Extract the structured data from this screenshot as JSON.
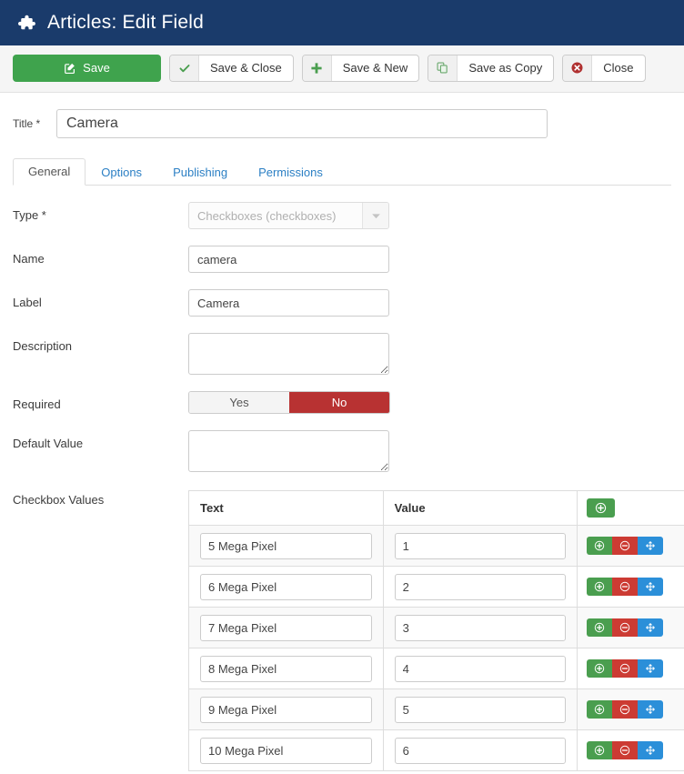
{
  "header": {
    "icon": "puzzle-piece-icon",
    "title": "Articles: Edit Field",
    "bg_color": "#1a3b6b"
  },
  "toolbar": {
    "buttons": [
      {
        "label": "Save",
        "icon": "pencil-square-icon",
        "style": "primary-green",
        "color": "#3fa34d"
      },
      {
        "label": "Save & Close",
        "icon": "check-icon",
        "style": "default",
        "color": "#4a9e4f"
      },
      {
        "label": "Save & New",
        "icon": "plus-icon",
        "style": "default",
        "color": "#4a9e4f"
      },
      {
        "label": "Save as Copy",
        "icon": "copy-icon",
        "style": "default",
        "color": "#6aa96e"
      },
      {
        "label": "Close",
        "icon": "close-circle-icon",
        "style": "default",
        "color": "#b03030"
      }
    ]
  },
  "title_field": {
    "label": "Title *",
    "value": "Camera"
  },
  "tabs": [
    {
      "label": "General",
      "active": true
    },
    {
      "label": "Options",
      "active": false
    },
    {
      "label": "Publishing",
      "active": false
    },
    {
      "label": "Permissions",
      "active": false
    }
  ],
  "form": {
    "type": {
      "label": "Type *",
      "value": "Checkboxes (checkboxes)",
      "disabled": true,
      "caret_icon": "chevron-down-icon"
    },
    "name": {
      "label": "Name",
      "value": "camera"
    },
    "label_field": {
      "label": "Label",
      "value": "Camera"
    },
    "description": {
      "label": "Description",
      "value": ""
    },
    "required": {
      "label": "Required",
      "options": [
        "Yes",
        "No"
      ],
      "selected": "No",
      "active_color": "#b83232"
    },
    "default_value": {
      "label": "Default Value",
      "value": ""
    }
  },
  "checkbox_values": {
    "label": "Checkbox Values",
    "columns": [
      "Text",
      "Value"
    ],
    "header_action_icon": "plus-circle-icon",
    "row_actions": [
      "plus-circle-icon",
      "minus-circle-icon",
      "move-arrows-icon"
    ],
    "rows": [
      {
        "text": "5 Mega Pixel",
        "value": "1"
      },
      {
        "text": "6 Mega Pixel",
        "value": "2"
      },
      {
        "text": "7 Mega Pixel",
        "value": "3"
      },
      {
        "text": "8 Mega Pixel",
        "value": "4"
      },
      {
        "text": "9 Mega Pixel",
        "value": "5"
      },
      {
        "text": "10 Mega Pixel",
        "value": "6"
      }
    ]
  }
}
